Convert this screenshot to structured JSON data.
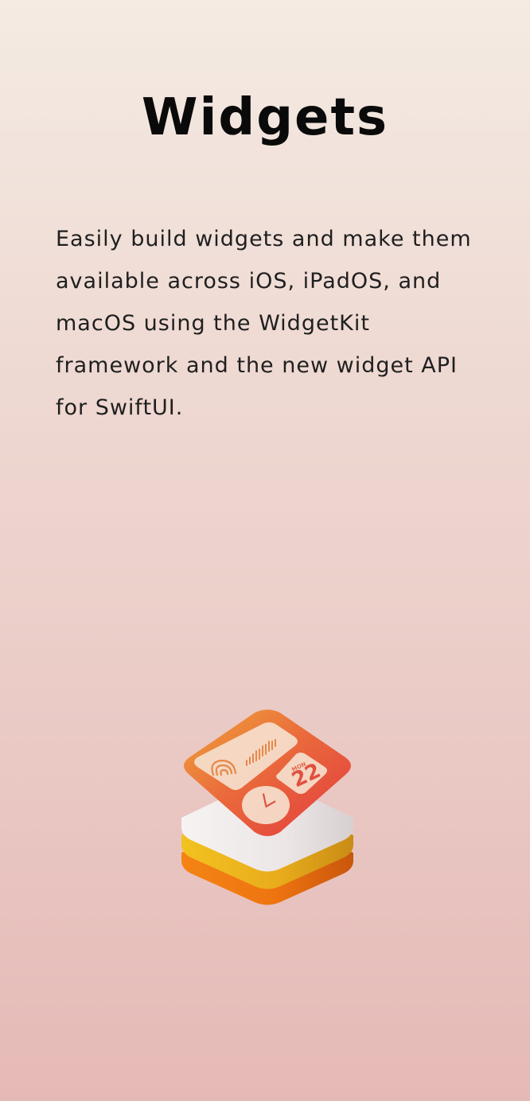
{
  "page": {
    "title": "Widgets",
    "description": "Easily build widgets and make them available across iOS, iPadOS, and macOS using the WidgetKit framework and the new widget API for SwiftUI."
  },
  "icon": {
    "name": "widgetkit-icon",
    "calendar_day": "MON",
    "calendar_date": "22"
  },
  "colors": {
    "background_top": "#f4ebe3",
    "background_bottom": "#e5b9b6",
    "title": "#0a0a0a",
    "body_text": "#1f1f1f",
    "icon_orange": "#f07a12",
    "icon_yellow": "#e8b21f",
    "icon_red": "#e0453e"
  }
}
